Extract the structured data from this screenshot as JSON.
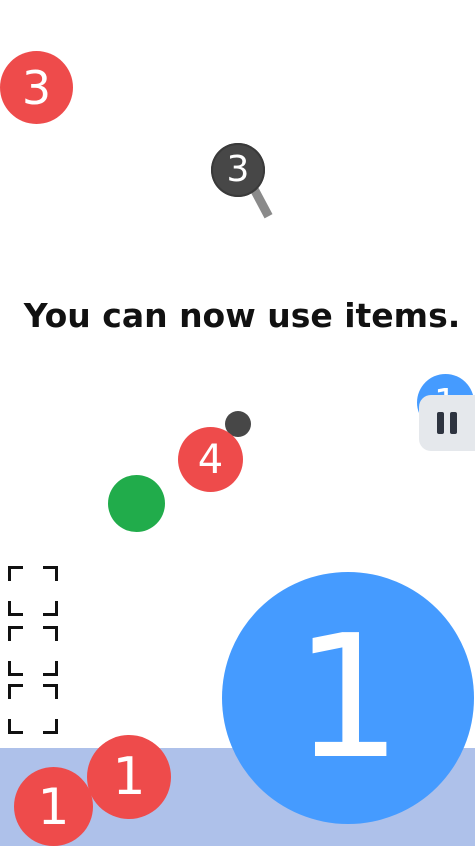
{
  "message": "You can now use items.",
  "colors": {
    "red": "#ee4b4b",
    "blue": "#459bff",
    "green": "#21ac4b",
    "dark": "#474747",
    "floor": "#aec1ea"
  },
  "balls": {
    "red_top_left": "3",
    "magnifier": "3",
    "red_mid": "4",
    "blue_edge": "1",
    "big_blue": "1",
    "red_bottom_a": "1",
    "red_bottom_b": "1"
  },
  "icons": {
    "magnifier": "magnifier-item-icon",
    "pause": "pause-icon",
    "item_slot": "item-slot-icon"
  }
}
